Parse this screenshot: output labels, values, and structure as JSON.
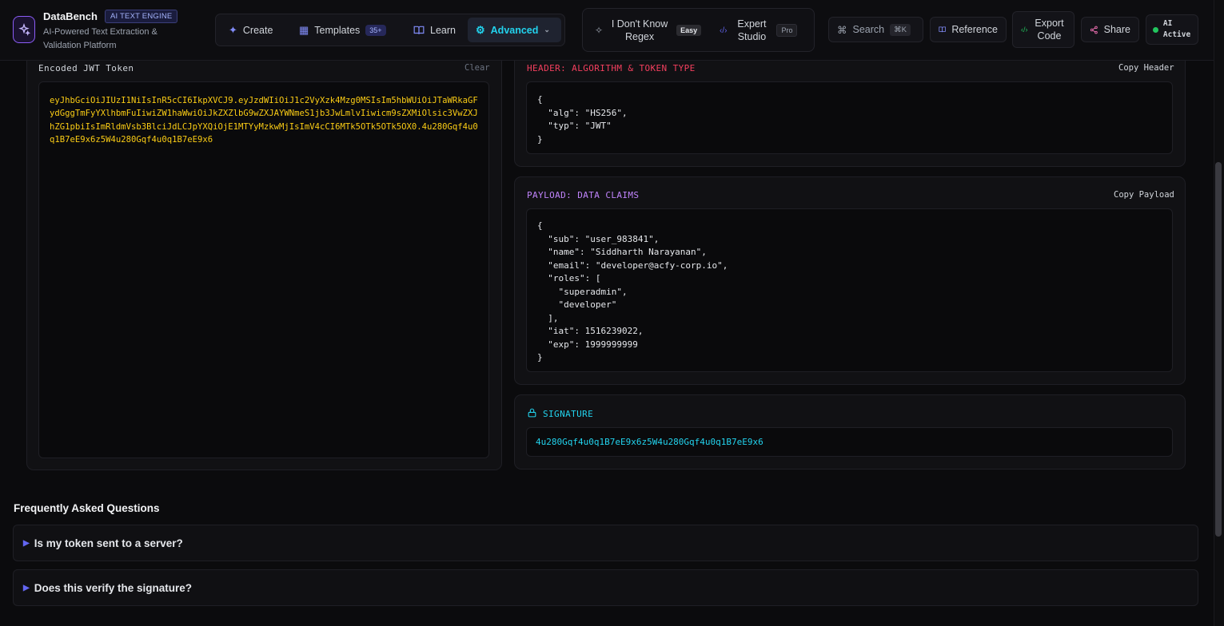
{
  "brand": {
    "name": "DataBench",
    "badge": "AI TEXT ENGINE",
    "subtitle": "AI-Powered Text Extraction & Validation Platform"
  },
  "nav": {
    "create": "Create",
    "templates": "Templates",
    "templates_count": "35+",
    "learn": "Learn",
    "advanced": "Advanced"
  },
  "modes": {
    "regex_label": "I Don't Know Regex",
    "regex_badge": "Easy",
    "studio_label": "Expert Studio",
    "studio_badge": "Pro"
  },
  "toolbar": {
    "search": "Search",
    "search_kbd": "⌘K",
    "reference": "Reference",
    "export": "Export Code",
    "share": "Share",
    "ai_status": "AI Active"
  },
  "encoded": {
    "label": "Encoded JWT Token",
    "clear": "Clear",
    "token": "eyJhbGciOiJIUzI1NiIsInR5cCI6IkpXVCJ9.eyJzdWIiOiJ1c2VyXzk4Mzg0MSIsIm5hbWUiOiJTaWRkaGFydGggTmFyYXlhbmFuIiwiZW1haWwiOiJkZXZlbG9wZXJAYWNmeS1jb3JwLmlvIiwicm9sZXMiOlsic3VwZXJhZG1pbiIsImRldmVsb3BlciJdLCJpYXQiOjE1MTYyMzkwMjIsImV4cCI6MTk5OTk5OTk5OX0.4u280Gqf4u0q1B7eE9x6z5W4u280Gqf4u0q1B7eE9x6"
  },
  "header_section": {
    "label": "HEADER: ALGORITHM & TOKEN TYPE",
    "copy": "Copy Header",
    "json": "{\n  \"alg\": \"HS256\",\n  \"typ\": \"JWT\"\n}"
  },
  "payload_section": {
    "label": "PAYLOAD: DATA CLAIMS",
    "copy": "Copy Payload",
    "json": "{\n  \"sub\": \"user_983841\",\n  \"name\": \"Siddharth Narayanan\",\n  \"email\": \"developer@acfy-corp.io\",\n  \"roles\": [\n    \"superadmin\",\n    \"developer\"\n  ],\n  \"iat\": 1516239022,\n  \"exp\": 1999999999\n}"
  },
  "signature_section": {
    "label": "SIGNATURE",
    "value": "4u280Gqf4u0q1B7eE9x6z5W4u280Gqf4u0q1B7eE9x6"
  },
  "faq": {
    "title": "Frequently Asked Questions",
    "items": [
      {
        "question": "Is my token sent to a server?"
      },
      {
        "question": "Does this verify the signature?"
      }
    ]
  },
  "colors": {
    "accent": "#22d3ee",
    "token": "#facc15",
    "header_label": "#f43f5e",
    "payload_label": "#c084fc",
    "signature": "#22d3ee",
    "status_dot": "#22c55e"
  }
}
